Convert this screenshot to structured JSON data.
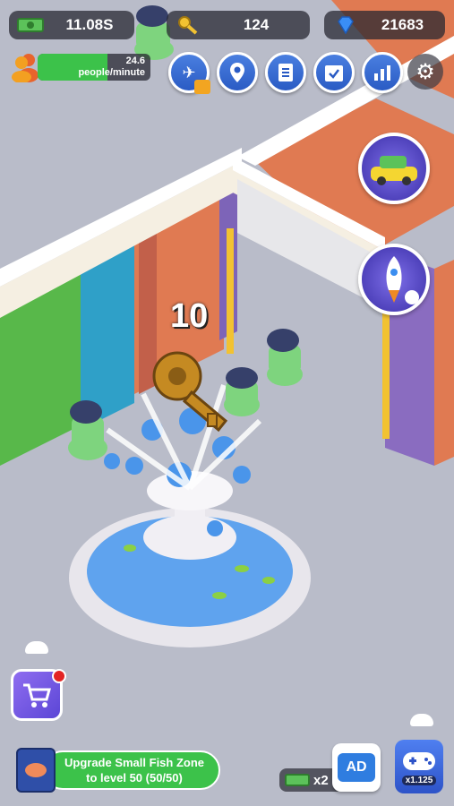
{
  "hud": {
    "cash_value": "11.08S",
    "keys_value": "124",
    "gems_value": "21683",
    "rate_value": "24.6",
    "rate_unit": "people/minute",
    "rate_fill": 0.62
  },
  "popup": {
    "reward_text": "10"
  },
  "upgrade": {
    "label": "Upgrade Small Fish Zone to level 50 (50/50)"
  },
  "bottom": {
    "cash_multiplier": "x2",
    "ad_label": "AD",
    "game_multiplier": "x1.125"
  },
  "colors": {
    "accent_blue": "#2a5bc4",
    "green": "#3cc24a",
    "wall_orange": "#e07a52",
    "water": "#5fa3ee"
  }
}
